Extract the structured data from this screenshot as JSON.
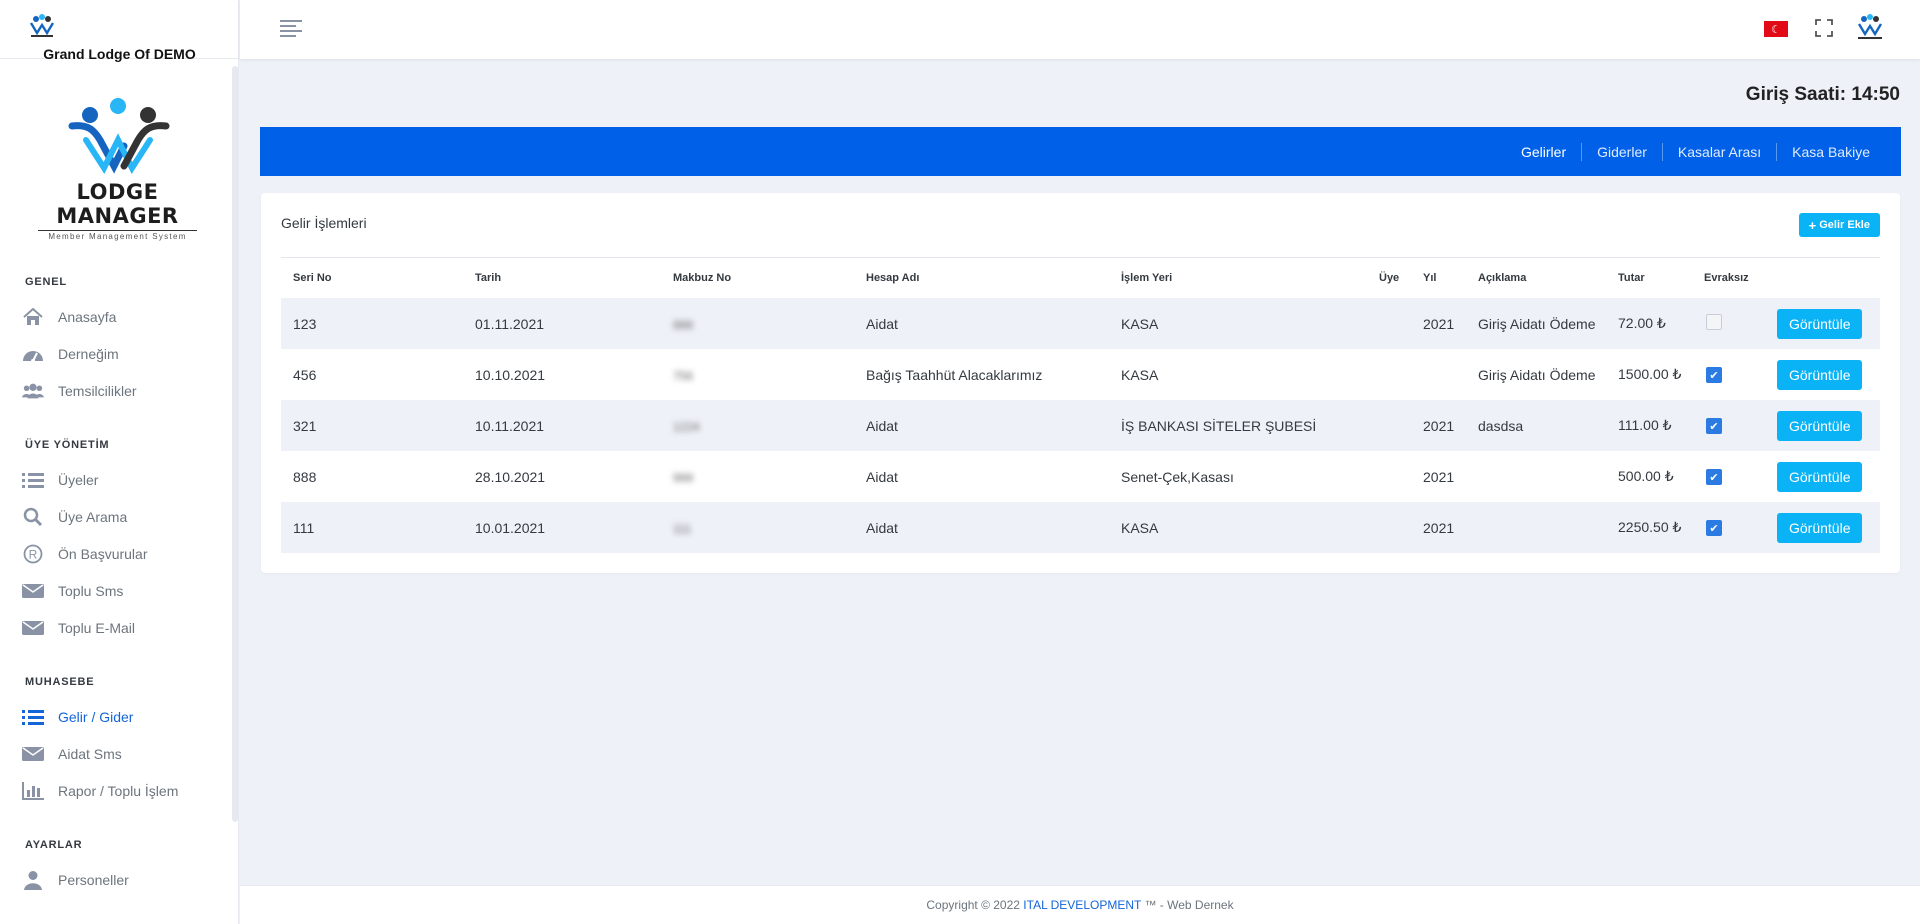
{
  "sidebar": {
    "org_name": "Grand Lodge Of DEMO",
    "brand": {
      "name": "LODGE MANAGER",
      "tagline": "Member Management System"
    },
    "sections": [
      {
        "title": "GENEL"
      },
      {
        "title": "ÜYE YÖNETİM"
      },
      {
        "title": "MUHASEBE"
      },
      {
        "title": "AYARLAR"
      }
    ],
    "items": [
      {
        "label": "Anasayfa",
        "icon": "home-icon"
      },
      {
        "label": "Derneğim",
        "icon": "dashboard-icon"
      },
      {
        "label": "Temsilcilikler",
        "icon": "users-icon"
      },
      {
        "label": "Üyeler",
        "icon": "list-icon"
      },
      {
        "label": "Üye Arama",
        "icon": "search-icon"
      },
      {
        "label": "Ön Başvurular",
        "icon": "registered-icon"
      },
      {
        "label": "Toplu Sms",
        "icon": "envelope-icon"
      },
      {
        "label": "Toplu E-Mail",
        "icon": "envelope-icon"
      },
      {
        "label": "Gelir / Gider",
        "icon": "list-icon",
        "active": true
      },
      {
        "label": "Aidat Sms",
        "icon": "envelope-icon"
      },
      {
        "label": "Rapor / Toplu İşlem",
        "icon": "bar-chart-icon"
      },
      {
        "label": "Personeller",
        "icon": "user-icon"
      }
    ]
  },
  "header": {
    "login_time": "Giriş Saati: 14:50",
    "flag": "turkey-flag-icon"
  },
  "tabs": [
    {
      "label": "Gelirler",
      "active": true
    },
    {
      "label": "Giderler"
    },
    {
      "label": "Kasalar Arası"
    },
    {
      "label": "Kasa Bakiye"
    }
  ],
  "card": {
    "title": "Gelir İşlemleri",
    "add_label": "Gelir Ekle"
  },
  "table": {
    "columns": [
      "Seri No",
      "Tarih",
      "Makbuz No",
      "Hesap Adı",
      "İşlem Yeri",
      "Üye",
      "Yıl",
      "Açıklama",
      "Tutar",
      "Evraksız",
      ""
    ],
    "rows": [
      {
        "seri": "123",
        "tarih": "01.11.2021",
        "makbuz": "888",
        "hesap": "Aidat",
        "yer": "KASA",
        "uye": "",
        "yil": "2021",
        "aciklama": "Giriş Aidatı Ödeme",
        "tutar": "72.00 ₺",
        "evraksiz": false,
        "action": "Görüntüle"
      },
      {
        "seri": "456",
        "tarih": "10.10.2021",
        "makbuz": "756",
        "hesap": "Bağış Taahhüt Alacaklarımız",
        "yer": "KASA",
        "uye": "",
        "yil": "",
        "aciklama": "Giriş Aidatı Ödeme",
        "tutar": "1500.00 ₺",
        "evraksiz": true,
        "action": "Görüntüle"
      },
      {
        "seri": "321",
        "tarih": "10.11.2021",
        "makbuz": "1224",
        "hesap": "Aidat",
        "yer": "İŞ BANKASI SİTELER ŞUBESİ",
        "uye": "",
        "yil": "2021",
        "aciklama": "dasdsa",
        "tutar": "111.00 ₺",
        "evraksiz": true,
        "action": "Görüntüle"
      },
      {
        "seri": "888",
        "tarih": "28.10.2021",
        "makbuz": "999",
        "hesap": "Aidat",
        "yer": "Senet-Çek,Kasası",
        "uye": "",
        "yil": "2021",
        "aciklama": "",
        "tutar": "500.00 ₺",
        "evraksiz": true,
        "action": "Görüntüle"
      },
      {
        "seri": "111",
        "tarih": "10.01.2021",
        "makbuz": "111",
        "hesap": "Aidat",
        "yer": "KASA",
        "uye": "",
        "yil": "2021",
        "aciklama": "",
        "tutar": "2250.50 ₺",
        "evraksiz": true,
        "action": "Görüntüle"
      }
    ]
  },
  "footer": {
    "prefix": "Copyright © 2022 ",
    "company": "ITAL DEVELOPMENT",
    "suffix": " ™ - Web Dernek"
  },
  "colors": {
    "primary": "#0061e8",
    "accent": "#0ab3f5",
    "active_nav": "#1365d8",
    "background": "#eef1f8"
  }
}
